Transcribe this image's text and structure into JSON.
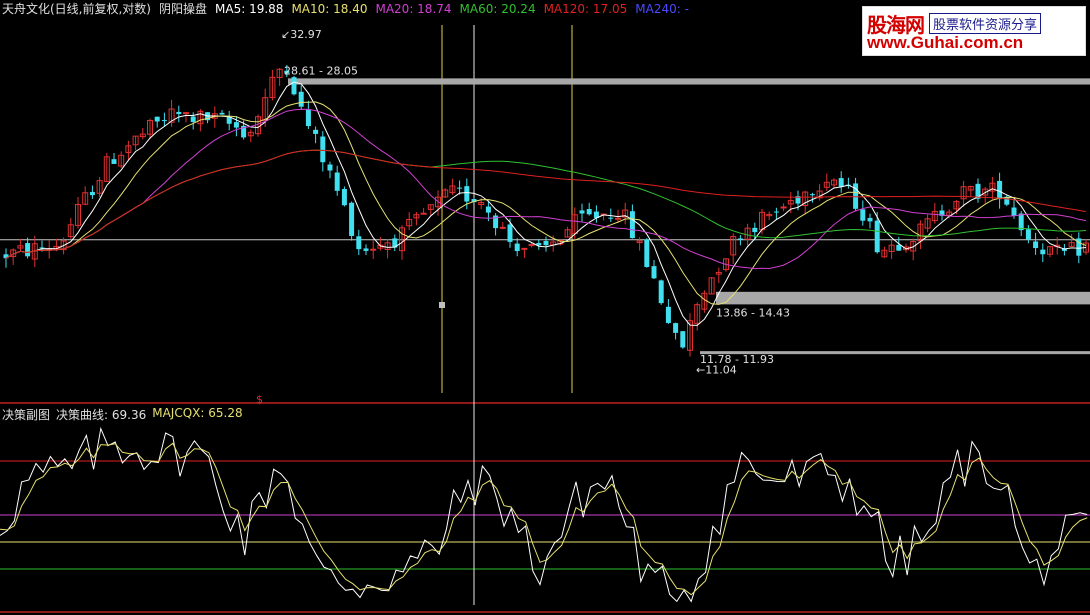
{
  "header": {
    "stock": "天舟文化(日线,前复权,对数)",
    "indicator": "阴阳操盘",
    "ma5": "MA5: 19.88",
    "ma10": "MA10: 18.40",
    "ma20": "MA20: 18.74",
    "ma60": "MA60: 20.24",
    "ma120": "MA120: 17.05",
    "ma240": "MA240: -"
  },
  "annotations": {
    "high": "32.97",
    "resistance": "28.61 - 28.05",
    "support": "13.86 - 14.43",
    "bottom_zone": "11.78 - 11.93",
    "low": "11.04",
    "dollar": "$"
  },
  "sub": {
    "title": "决策副图",
    "curve": "决策曲线: 69.36",
    "majcqx": "MAJCQX: 65.28"
  },
  "logo": {
    "brand": "股海网",
    "tag": "股票软件资源分享",
    "url": "www.Guhai.com.cn"
  },
  "colors": {
    "candle_up": "#e03030",
    "candle_down": "#40e0f0",
    "ma5": "#ffffff",
    "ma10": "#e6e070",
    "ma20": "#d040d0",
    "ma60": "#30c030",
    "ma120": "#e02020",
    "ma240": "#4040ff",
    "level": "#a8a8a8",
    "vline": "#e0d040",
    "border": "#c02020"
  },
  "chart_data": {
    "type": "candlestick",
    "main": {
      "ylim_log": [
        10.2,
        34.5
      ],
      "resistance_zone": [
        28.05,
        28.61
      ],
      "support_zone": [
        13.86,
        14.43
      ],
      "bottom_zone": [
        11.78,
        11.93
      ],
      "high": 32.97,
      "low": 11.04
    },
    "sub": {
      "ylim": [
        0,
        100
      ],
      "reference_levels": [
        80,
        50,
        35,
        20
      ]
    }
  }
}
